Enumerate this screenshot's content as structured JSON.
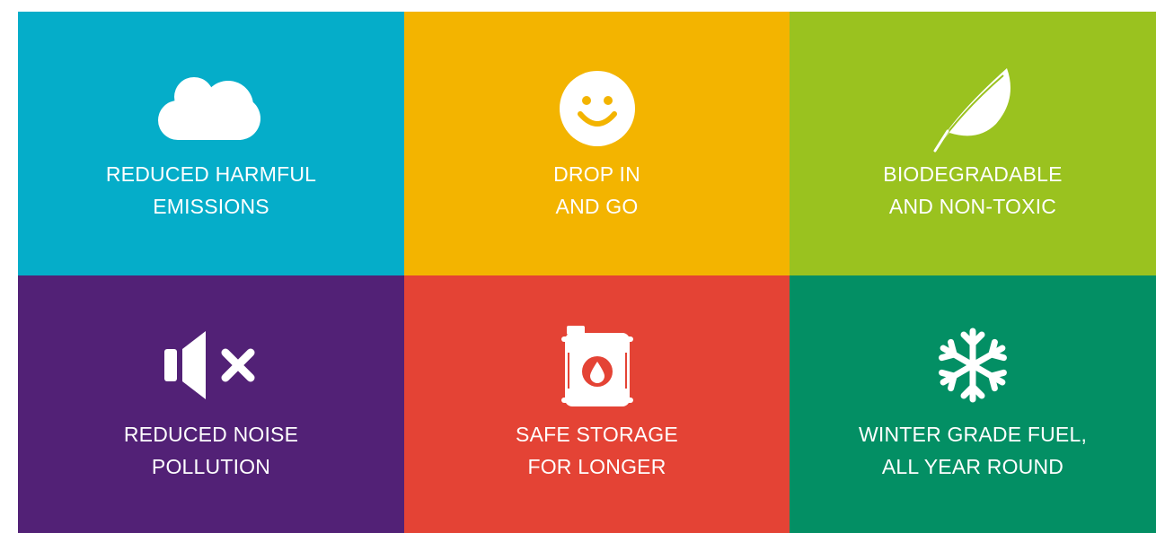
{
  "tiles": [
    {
      "icon": "cloud-icon",
      "color": "#05adc9",
      "line1": "REDUCED HARMFUL",
      "line2": "EMISSIONS"
    },
    {
      "icon": "smiley-face-icon",
      "color": "#f3b400",
      "line1": "DROP IN",
      "line2": "AND GO"
    },
    {
      "icon": "leaf-icon",
      "color": "#9ac21f",
      "line1": "BIODEGRADABLE",
      "line2": "AND NON-TOXIC"
    },
    {
      "icon": "speaker-muted-icon",
      "color": "#522176",
      "line1": "REDUCED NOISE",
      "line2": "POLLUTION"
    },
    {
      "icon": "fuel-drum-icon",
      "color": "#e44335",
      "line1": "SAFE STORAGE",
      "line2": "FOR LONGER"
    },
    {
      "icon": "snowflake-icon",
      "color": "#038f64",
      "line1": "WINTER GRADE FUEL,",
      "line2": "ALL YEAR ROUND"
    }
  ]
}
